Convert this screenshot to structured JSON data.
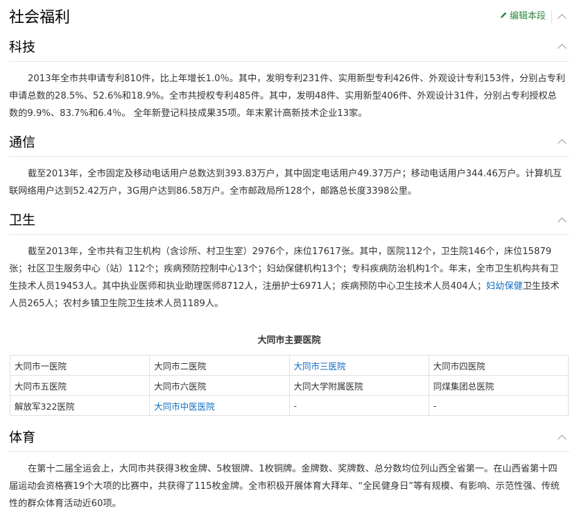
{
  "page": {
    "title": "社会福利",
    "edit_label": "编辑本段"
  },
  "sections": [
    {
      "title": "科技",
      "paragraph": "2013年全市共申请专利810件，比上年增长1.0％。其中，发明专利231件、实用新型专利426件、外观设计专利153件，分别占专利申请总数的28.5%、52.6%和18.9%。全市共授权专利485件。其中，发明48件、实用新型406件、外观设计31件，分别占专利授权总数的9.9%、83.7%和6.4％。 全年新登记科技成果35项。年末累计高新技术企业13家。"
    },
    {
      "title": "通信",
      "paragraph": "截至2013年，全市固定及移动电话用户总数达到393.83万户，其中固定电话用户49.37万户；移动电话用户344.46万户。计算机互联网络用户达到52.42万户，3G用户达到86.58万户。全市邮政局所128个，邮路总长度3398公里。"
    },
    {
      "title": "卫生",
      "paragraph_before": "截至2013年，全市共有卫生机构（含诊所、村卫生室）2976个，床位17617张。其中，医院112个，卫生院146个，床位15879张；社区卫生服务中心（站）112个；疾病预防控制中心13个；妇幼保健机构13个；专科疾病防治机构1个。年末，全市卫生机构共有卫生技术人员19453人。其中执业医师和执业助理医师8712人，注册护士6971人；疾病预防中心卫生技术人员404人；",
      "paragraph_link": "妇幼保健",
      "paragraph_after": "卫生技术人员265人；农村乡镇卫生院卫生技术人员1189人。"
    },
    {
      "title": "体育",
      "paragraph": "在第十二届全运会上，大同市共获得3枚金牌、5枚银牌、1枚铜牌。金牌数、奖牌数、总分数均位列山西全省第一。在山西省第十四届运动会资格赛19个大项的比赛中，共获得了115枚金牌。全市积极开展体育大拜年、“全民健身日”等有规模、有影响、示范性强、传统性的群众体育活动近60项。"
    }
  ],
  "hospital_table": {
    "caption": "大同市主要医院",
    "rows": [
      [
        "大同市一医院",
        "大同市二医院",
        "大同市三医院",
        "大同市四医院"
      ],
      [
        "大同市五医院",
        "大同市六医院",
        "大同大学附属医院",
        "同煤集团总医院"
      ],
      [
        "解放军322医院",
        "大同市中医医院",
        "-",
        "-"
      ]
    ]
  },
  "icons": {
    "edit": "pencil-icon",
    "collapse": "chevron-up-icon"
  },
  "colors": {
    "link": "#136ec2",
    "edit": "#2c8a3c"
  }
}
